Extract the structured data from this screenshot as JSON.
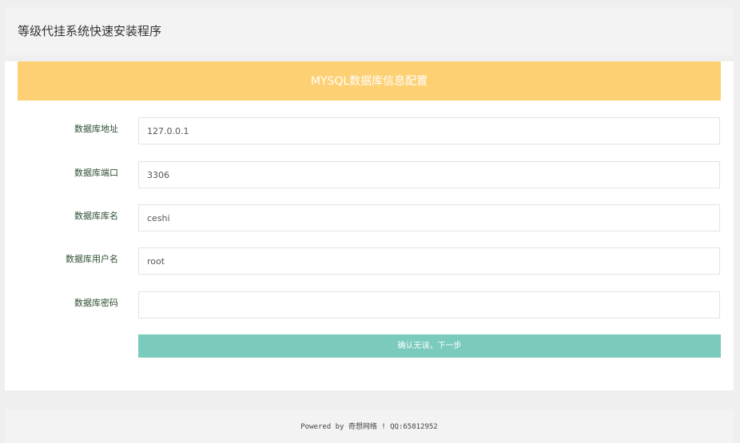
{
  "header": {
    "title": "等级代挂系统快速安装程序"
  },
  "panel": {
    "heading": "MYSQL数据库信息配置",
    "fields": [
      {
        "label": "数据库地址",
        "value": "127.0.0.1",
        "placeholder": ""
      },
      {
        "label": "数据库端口",
        "value": "3306",
        "placeholder": ""
      },
      {
        "label": "数据库库名",
        "value": "ceshi",
        "placeholder": ""
      },
      {
        "label": "数据库用户名",
        "value": "root",
        "placeholder": ""
      },
      {
        "label": "数据库密码",
        "value": "",
        "placeholder": ""
      }
    ],
    "submit_label": "确认无误，下一步"
  },
  "footer": {
    "text": "Powered by 奇想网络 ! QQ:65812952"
  },
  "colors": {
    "heading_bg": "#fdd073",
    "button_bg": "#7acbbc",
    "page_bg": "#efefef"
  }
}
